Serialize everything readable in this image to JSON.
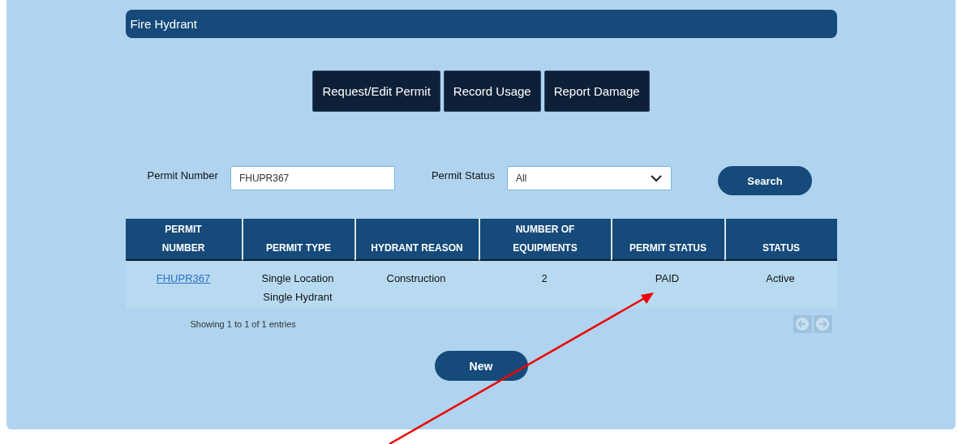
{
  "header": {
    "title": "Fire Hydrant"
  },
  "actions": [
    "Request/Edit Permit",
    "Record Usage",
    "Report Damage"
  ],
  "filters": [
    {
      "kind": "text",
      "label": "Permit Number",
      "value": "FHUPR367"
    },
    {
      "kind": "select",
      "label": "Permit Status",
      "value": "All"
    }
  ],
  "search_button": "Search",
  "table": {
    "columns": [
      "PERMIT NUMBER",
      "PERMIT TYPE",
      "HYDRANT REASON",
      "NUMBER OF EQUIPMENTS",
      "PERMIT STATUS",
      "STATUS"
    ],
    "rows": [
      [
        {
          "kind": "link",
          "text": "FHUPR367"
        },
        {
          "kind": "text",
          "text": "Single Location Single Hydrant"
        },
        {
          "kind": "text",
          "text": "Construction"
        },
        {
          "kind": "text",
          "text": "2"
        },
        {
          "kind": "text",
          "text": "PAID"
        },
        {
          "kind": "text",
          "text": "Active"
        }
      ]
    ]
  },
  "footer": {
    "info": "Showing 1 to 1 of 1 entries",
    "pager": [
      {
        "kind": "prev",
        "disabled": true
      },
      {
        "kind": "next",
        "disabled": true
      }
    ]
  },
  "new_button": "New",
  "annotation": {
    "kind": "arrow"
  }
}
